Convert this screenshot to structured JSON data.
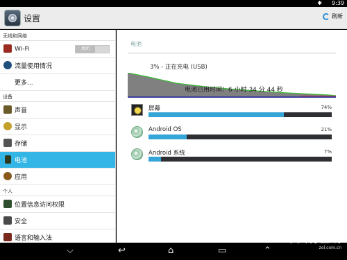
{
  "status_bar": {
    "time": "9:39",
    "bluetooth": "✱"
  },
  "action_bar": {
    "title": "设置",
    "refresh_label": "刷新"
  },
  "sidebar": {
    "sections": [
      {
        "header": "无线和网络",
        "items": [
          {
            "label": "Wi-Fi",
            "toggle": "关闭",
            "icon": "wifi-icon",
            "color": "#9b2a22"
          },
          {
            "label": "流量使用情况",
            "icon": "data-usage-icon",
            "color": "#1f4f7d"
          },
          {
            "label": "更多...",
            "icon": "",
            "color": ""
          }
        ]
      },
      {
        "header": "设备",
        "items": [
          {
            "label": "声音",
            "icon": "speaker-icon",
            "color": "#6b5a2a"
          },
          {
            "label": "显示",
            "icon": "display-icon",
            "color": "#c4a12a"
          },
          {
            "label": "存储",
            "icon": "storage-icon",
            "color": "#555555"
          },
          {
            "label": "电池",
            "icon": "battery-icon",
            "color": "#2e3a1f",
            "selected": true
          },
          {
            "label": "应用",
            "icon": "apps-icon",
            "color": "#8a5a1d"
          }
        ]
      },
      {
        "header": "个人",
        "items": [
          {
            "label": "位置信息访问权限",
            "icon": "location-icon",
            "color": "#2f4f2f"
          },
          {
            "label": "安全",
            "icon": "lock-icon",
            "color": "#4a4a4a"
          },
          {
            "label": "语言和输入法",
            "icon": "language-icon",
            "color": "#7a2a1d"
          }
        ]
      }
    ]
  },
  "battery": {
    "title": "电池",
    "status": "3% - 正在充电 (USB)",
    "time_since": "电池已用时间：6 小时 34 分 44 秒",
    "usage": [
      {
        "name": "屏幕",
        "percent": "74%",
        "value": 74,
        "icon": "screen-brightness-icon"
      },
      {
        "name": "Android OS",
        "percent": "21%",
        "value": 21,
        "icon": "android-os-icon"
      },
      {
        "name": "Android 系统",
        "percent": "7%",
        "value": 7,
        "icon": "android-system-icon"
      }
    ]
  },
  "nav_bar": {
    "down": "⌵",
    "back": "↩",
    "home": "⌂",
    "recents": "▭",
    "up": "⌃"
  },
  "watermark": {
    "big": "Z 中关村在线",
    "small": "zol.com.cn"
  },
  "colors": {
    "accent": "#33b5e5",
    "usage_bar": "#35a5d8"
  }
}
